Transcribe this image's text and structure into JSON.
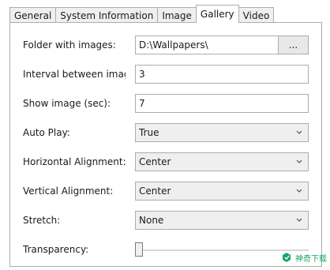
{
  "tabs": [
    {
      "label": "General",
      "active": false
    },
    {
      "label": "System Information",
      "active": false
    },
    {
      "label": "Image",
      "active": false
    },
    {
      "label": "Gallery",
      "active": true
    },
    {
      "label": "Video",
      "active": false
    }
  ],
  "form": {
    "folder": {
      "label": "Folder with images:",
      "value": "D:\\Wallpapers\\",
      "browse_label": "..."
    },
    "interval": {
      "label": "Interval between images",
      "value": "3"
    },
    "show_image": {
      "label": "Show image (sec):",
      "value": "7"
    },
    "auto_play": {
      "label": "Auto Play:",
      "value": "True"
    },
    "h_align": {
      "label": "Horizontal Alignment:",
      "value": "Center"
    },
    "v_align": {
      "label": "Vertical Alignment:",
      "value": "Center"
    },
    "stretch": {
      "label": "Stretch:",
      "value": "None"
    },
    "transparency": {
      "label": "Transparency:",
      "level": 0
    }
  },
  "icons": {
    "dropdown": "chevron-down-icon",
    "watermark": "logo-icon"
  },
  "watermark_text": "神奇下载",
  "colors": {
    "border": "#adadad",
    "field_bg": "#ffffff",
    "select_bg": "#efefef",
    "watermark": "#1aa56b"
  }
}
